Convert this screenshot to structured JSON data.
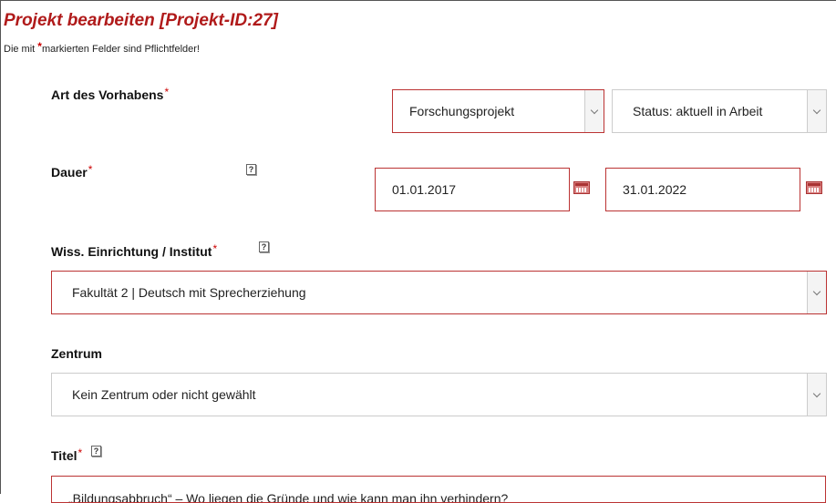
{
  "page": {
    "title": "Projekt bearbeiten [Projekt-ID:27]",
    "note_prefix": "Die mit ",
    "note_star": "*",
    "note_suffix": "markierten Felder sind Pflichtfelder!"
  },
  "help_glyph": "?",
  "required_mark": "*",
  "art": {
    "label": "Art des Vorhabens",
    "value": "Forschungsprojekt",
    "status_value": "Status: aktuell in Arbeit"
  },
  "dauer": {
    "label": "Dauer",
    "start": "01.01.2017",
    "end": "31.01.2022"
  },
  "einrichtung": {
    "label": "Wiss. Einrichtung / Institut",
    "value": "Fakultät 2 | Deutsch mit Sprecherziehung"
  },
  "zentrum": {
    "label": "Zentrum",
    "value": "Kein Zentrum oder nicht gewählt"
  },
  "titel": {
    "label": "Titel",
    "value": "„Bildungsabbruch“ – Wo liegen die Gründe und wie kann man ihn verhindern?"
  },
  "colors": {
    "accent": "#b01a1a",
    "required": "#cc0000",
    "border_red": "#bb3333"
  },
  "icons": {
    "help": "help-icon",
    "calendar": "calendar-icon",
    "dropdown": "chevron-down-icon"
  }
}
